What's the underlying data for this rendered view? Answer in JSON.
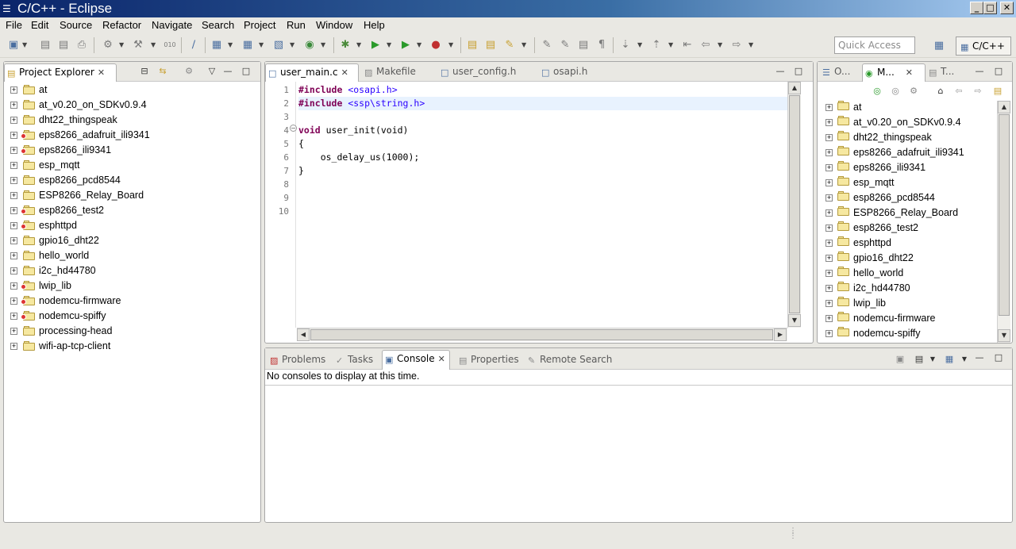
{
  "window": {
    "title": "C/C++ - Eclipse"
  },
  "menu": [
    "File",
    "Edit",
    "Source",
    "Refactor",
    "Navigate",
    "Search",
    "Project",
    "Run",
    "Window",
    "Help"
  ],
  "toolbar": {
    "quick_access_placeholder": "Quick Access",
    "perspective_label": "C/C++"
  },
  "project_explorer": {
    "title": "Project Explorer",
    "projects": [
      {
        "name": "at",
        "error": false
      },
      {
        "name": "at_v0.20_on_SDKv0.9.4",
        "error": false
      },
      {
        "name": "dht22_thingspeak",
        "error": false
      },
      {
        "name": "eps8266_adafruit_ili9341",
        "error": true
      },
      {
        "name": "eps8266_ili9341",
        "error": true
      },
      {
        "name": "esp_mqtt",
        "error": false
      },
      {
        "name": "esp8266_pcd8544",
        "error": false
      },
      {
        "name": "ESP8266_Relay_Board",
        "error": false
      },
      {
        "name": "esp8266_test2",
        "error": true
      },
      {
        "name": "esphttpd",
        "error": true
      },
      {
        "name": "gpio16_dht22",
        "error": false
      },
      {
        "name": "hello_world",
        "error": false
      },
      {
        "name": "i2c_hd44780",
        "error": false
      },
      {
        "name": "lwip_lib",
        "error": true
      },
      {
        "name": "nodemcu-firmware",
        "error": true
      },
      {
        "name": "nodemcu-spiffy",
        "error": true
      },
      {
        "name": "processing-head",
        "error": false
      },
      {
        "name": "wifi-ap-tcp-client",
        "error": false
      }
    ]
  },
  "editor": {
    "tabs": [
      {
        "label": "user_main.c",
        "active": true
      },
      {
        "label": "Makefile",
        "active": false
      },
      {
        "label": "user_config.h",
        "active": false
      },
      {
        "label": "osapi.h",
        "active": false
      }
    ],
    "line_numbers": [
      "1",
      "2",
      "3",
      "4",
      "5",
      "6",
      "7",
      "8",
      "9",
      "10"
    ],
    "lines": [
      {
        "kw": "#include",
        "rest": " <osapi.h>"
      },
      {
        "kw": "#include",
        "rest": " <ssp\\string.h>"
      },
      {
        "kw": "",
        "rest": ""
      },
      {
        "kw": "void",
        "rest": " user_init(void)"
      },
      {
        "kw": "",
        "rest": "{"
      },
      {
        "kw": "",
        "rest": "    os_delay_us(1000);"
      },
      {
        "kw": "",
        "rest": "}"
      },
      {
        "kw": "",
        "rest": ""
      },
      {
        "kw": "",
        "rest": ""
      },
      {
        "kw": "",
        "rest": ""
      }
    ]
  },
  "right_panel": {
    "tabs": [
      {
        "label": "O...",
        "active": false
      },
      {
        "label": "M...",
        "active": true
      },
      {
        "label": "T...",
        "active": false
      }
    ],
    "projects": [
      "at",
      "at_v0.20_on_SDKv0.9.4",
      "dht22_thingspeak",
      "eps8266_adafruit_ili9341",
      "eps8266_ili9341",
      "esp_mqtt",
      "esp8266_pcd8544",
      "ESP8266_Relay_Board",
      "esp8266_test2",
      "esphttpd",
      "gpio16_dht22",
      "hello_world",
      "i2c_hd44780",
      "lwip_lib",
      "nodemcu-firmware",
      "nodemcu-spiffy"
    ]
  },
  "bottom_panel": {
    "tabs": [
      {
        "label": "Problems",
        "active": false
      },
      {
        "label": "Tasks",
        "active": false
      },
      {
        "label": "Console",
        "active": true
      },
      {
        "label": "Properties",
        "active": false
      },
      {
        "label": "Remote Search",
        "active": false
      }
    ],
    "message": "No consoles to display at this time."
  }
}
